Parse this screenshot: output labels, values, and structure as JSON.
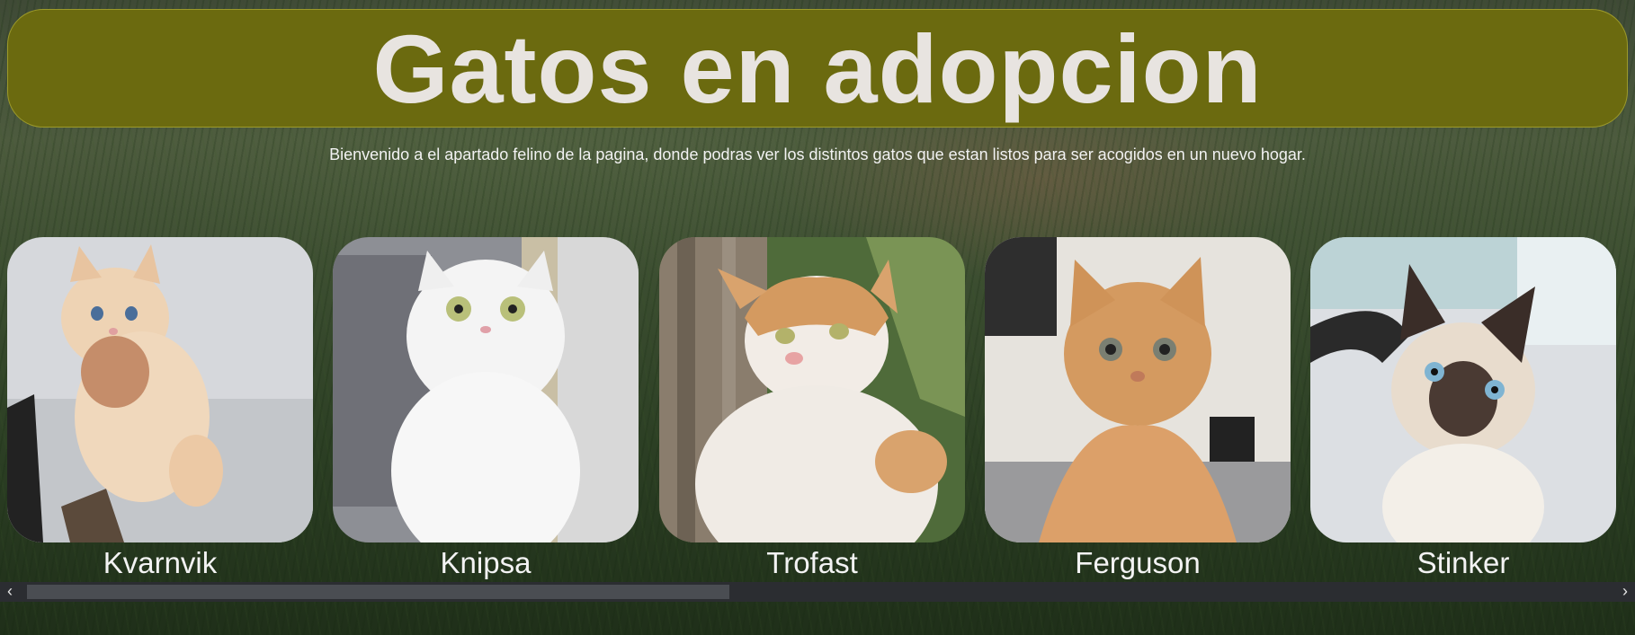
{
  "header": {
    "title": "Gatos en adopcion",
    "subtitle": "Bienvenido a el apartado felino de la pagina, donde podras ver los distintos gatos que estan listos para ser acogidos en un nuevo hogar."
  },
  "cats": [
    {
      "name": "Kvarnvik"
    },
    {
      "name": "Knipsa"
    },
    {
      "name": "Trofast"
    },
    {
      "name": "Ferguson"
    },
    {
      "name": "Stinker"
    }
  ],
  "scrollbar": {
    "left_arrow": "‹",
    "right_arrow": "›",
    "thumb_fraction": 0.44
  },
  "colors": {
    "banner": "#6b6a0f",
    "title_text": "#e8e4e0"
  }
}
